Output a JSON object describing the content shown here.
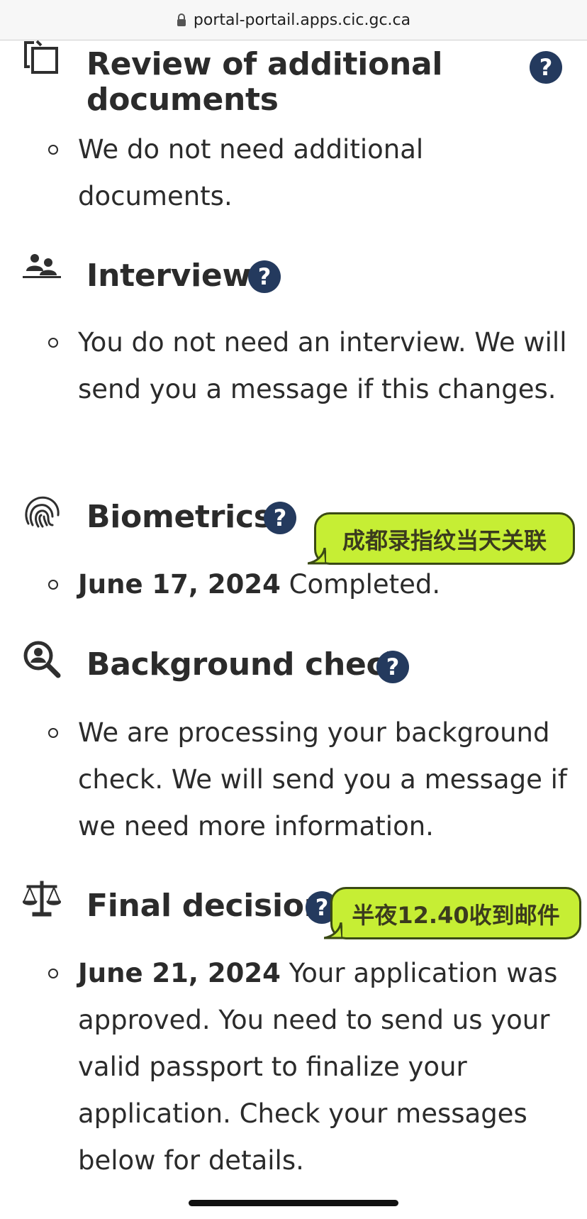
{
  "browser": {
    "url": "portal-portail.apps.cic.gc.ca"
  },
  "sections": [
    {
      "title": "Review of additional documents",
      "title_line1": "Review of additional",
      "title_line2": "documents",
      "icon": "documents-icon",
      "status_date": "",
      "status_text": "We do not need additional documents."
    },
    {
      "title": "Interview",
      "icon": "people-icon",
      "status_date": "",
      "status_text": "You do not need an interview. We will send you a message if this changes."
    },
    {
      "title": "Biometrics",
      "icon": "fingerprint-icon",
      "status_date": "June 17, 2024",
      "status_text": "Completed."
    },
    {
      "title": "Background check",
      "icon": "person-search-icon",
      "status_date": "",
      "status_text": "We are processing your background check. We will send you a message if we need more information."
    },
    {
      "title": "Final decision",
      "icon": "scales-icon",
      "status_date": "June 21, 2024",
      "status_text": "Your application was approved. You need to send us your valid passport to finalize your application. Check your messages below for details."
    }
  ],
  "help_label": "?",
  "annotations": [
    {
      "text": "成都录指纹当天关联",
      "color": "#c6ee34"
    },
    {
      "text": "半夜12.40收到邮件",
      "color": "#c6ee34"
    }
  ]
}
